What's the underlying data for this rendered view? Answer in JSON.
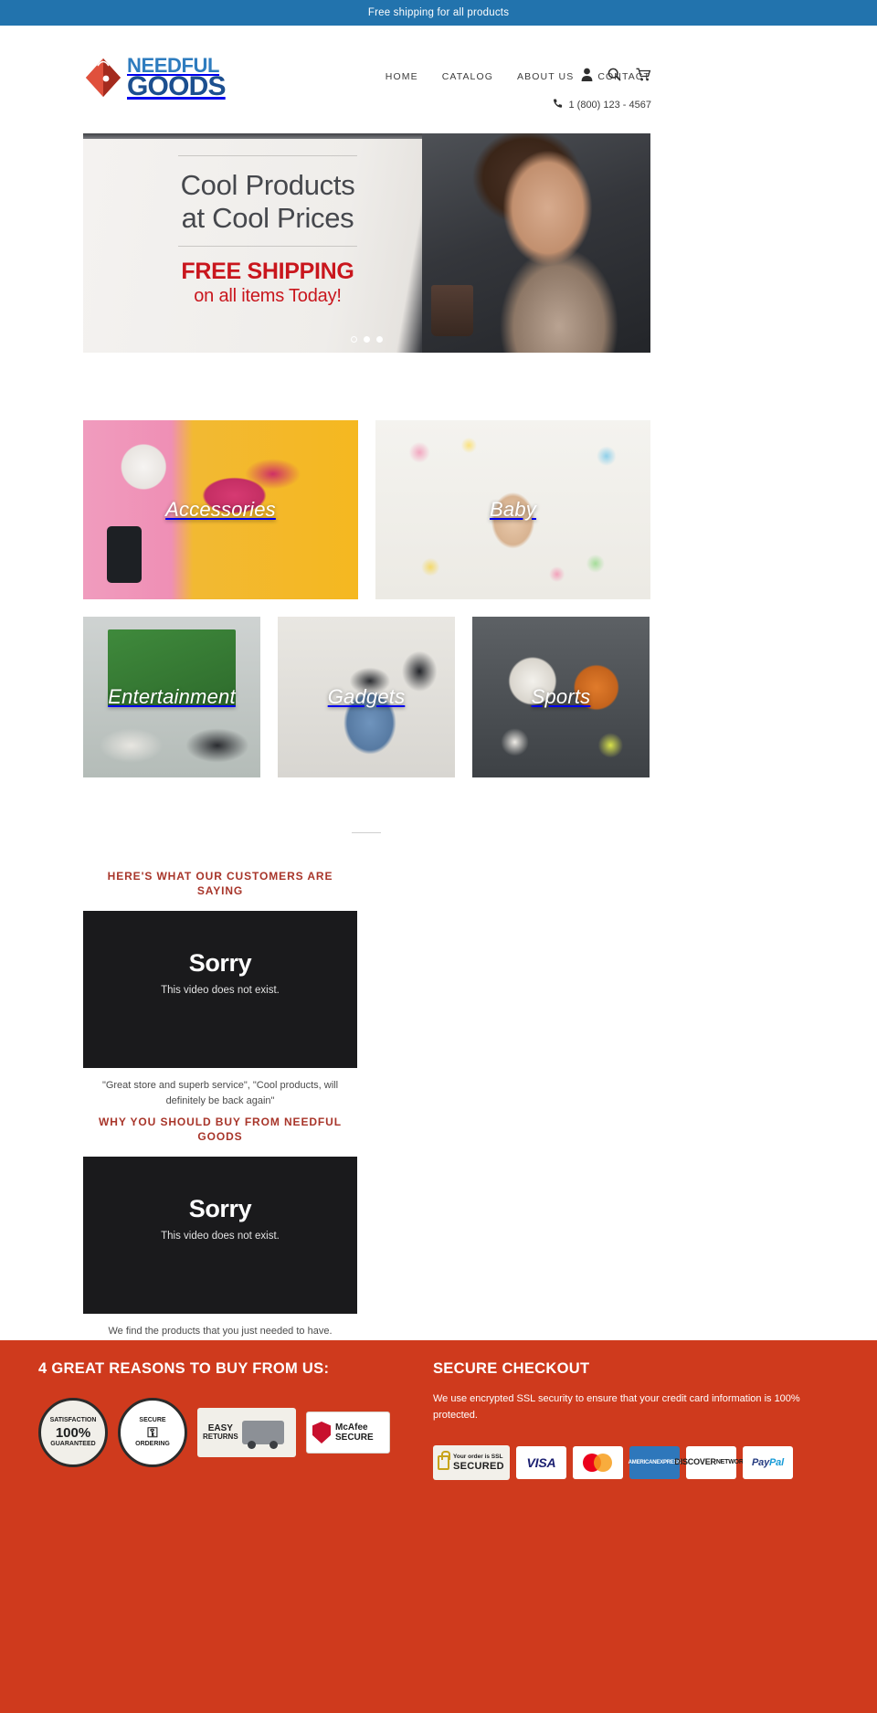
{
  "announcement": {
    "text": "Free shipping for all products"
  },
  "header": {
    "logo": {
      "top": "NEEDFUL",
      "bottom": "GOODS",
      "icon": "shopping-bag-icon"
    },
    "nav": [
      {
        "label": "HOME"
      },
      {
        "label": "CATALOG"
      },
      {
        "label": "ABOUT US"
      },
      {
        "label": "CONTACT"
      }
    ],
    "icons": [
      {
        "name": "account-icon"
      },
      {
        "name": "search-icon"
      },
      {
        "name": "cart-icon"
      }
    ],
    "phone": "1 (800) 123 - 4567",
    "phone_icon": "phone-icon"
  },
  "hero": {
    "headline_line1": "Cool Products",
    "headline_line2": "at Cool Prices",
    "promo": "FREE SHIPPING",
    "promo_sub": "on all items Today!",
    "slides": 3,
    "active_slide": 1
  },
  "categories": [
    {
      "label": "Accessories"
    },
    {
      "label": "Baby"
    },
    {
      "label": "Entertainment"
    },
    {
      "label": "Gadgets"
    },
    {
      "label": "Sports"
    }
  ],
  "sections": [
    {
      "heading": "HERE'S WHAT OUR CUSTOMERS ARE SAYING",
      "video_title": "Sorry",
      "video_sub": "This video does not exist.",
      "caption": "\"Great store and superb service\", \"Cool products, will definitely be back again\""
    },
    {
      "heading": "WHY YOU SHOULD BUY FROM NEEDFUL GOODS",
      "video_title": "Sorry",
      "video_sub": "This video does not exist.",
      "caption": "We find the products that you just needed to have."
    }
  ],
  "footer": {
    "reasons_heading": "4 GREAT REASONS TO BUY FROM US:",
    "badges": [
      {
        "name": "satisfaction-guaranteed-seal",
        "l1": "SATISFACTION",
        "big": "100%",
        "l2": "GUARANTEED"
      },
      {
        "name": "secure-ordering-seal",
        "l1": "SECURE",
        "big": "⚿",
        "l2": "ORDERING"
      },
      {
        "name": "easy-returns-badge",
        "l1": "EASY",
        "l2": "RETURNS"
      },
      {
        "name": "mcafee-secure-badge",
        "l1": "McAfee",
        "l2": "SECURE"
      }
    ],
    "checkout_heading": "SECURE CHECKOUT",
    "checkout_text": "We use encrypted SSL security to ensure that your credit card information is 100% protected.",
    "payments": [
      {
        "name": "ssl-secured-badge",
        "small": "Your order is SSL",
        "big": "SECURED"
      },
      {
        "name": "visa-card",
        "label": "VISA"
      },
      {
        "name": "mastercard-card",
        "label": "MasterCard"
      },
      {
        "name": "amex-card",
        "l1": "AMERICAN",
        "l2": "EXPRESS"
      },
      {
        "name": "discover-card",
        "l1": "DISCOVER",
        "l2": "NETWORK"
      },
      {
        "name": "paypal-card",
        "l1": "Pay",
        "l2": "Pal"
      }
    ]
  },
  "colors": {
    "announce_bg": "#2273ad",
    "footer_bg": "#cf3a1d",
    "heading_red": "#a8352a",
    "promo_red": "#c9161d",
    "logo_blue": "#1c4f8f"
  }
}
